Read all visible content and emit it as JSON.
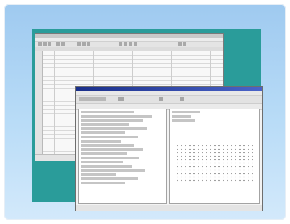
{
  "colors": {
    "background_top": "#9fcaf0",
    "background_bottom": "#d3e9fb",
    "desktop_teal": "#2a9c9a",
    "dialog_titlebar": "#1a2f8a"
  },
  "spreadsheet_window": {
    "title": "",
    "status": ""
  },
  "dialog_window": {
    "title": "",
    "status": ""
  }
}
